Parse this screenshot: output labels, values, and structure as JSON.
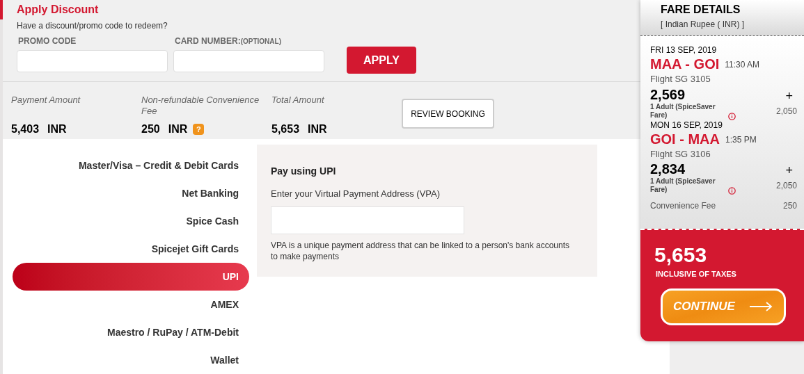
{
  "discount": {
    "title": "Apply Discount",
    "subtitle": "Have a discount/promo code to redeem?",
    "promo_label": "PROMO CODE",
    "card_label": "CARD NUMBER:",
    "card_label_note": "(OPTIONAL)",
    "apply_button": "APPLY"
  },
  "summary": {
    "items": [
      {
        "label": "Payment Amount",
        "amount": "5,403",
        "currency": "INR",
        "help": false
      },
      {
        "label": "Non-refundable Convenience Fee",
        "amount": "250",
        "currency": "INR",
        "help": true,
        "help_icon": "?"
      },
      {
        "label": "Total Amount",
        "amount": "5,653",
        "currency": "INR",
        "help": false
      }
    ],
    "review_button": "REVIEW BOOKING"
  },
  "payment_methods": [
    {
      "label": "Master/Visa – Credit & Debit Cards",
      "selected": false
    },
    {
      "label": "Net Banking",
      "selected": false
    },
    {
      "label": "Spice Cash",
      "selected": false
    },
    {
      "label": "Spicejet Gift Cards",
      "selected": false
    },
    {
      "label": "UPI",
      "selected": true
    },
    {
      "label": "AMEX",
      "selected": false
    },
    {
      "label": "Maestro / RuPay / ATM-Debit",
      "selected": false
    },
    {
      "label": "Wallet",
      "selected": false
    }
  ],
  "upi_panel": {
    "title": "Pay using UPI",
    "field_label": "Enter your Virtual Payment Address (VPA)",
    "note": "VPA is a unique payment address that can be linked to a person's bank accounts to make payments"
  },
  "fare_details": {
    "title": "FARE DETAILS",
    "currency": "[ Indian Rupee ( INR) ]",
    "flights": [
      {
        "date": "FRI 13 SEP, 2019",
        "route": "MAA - GOI",
        "time": "11:30 AM",
        "flight": "Flight SG 3105",
        "price": "2,569",
        "expand": "+",
        "passenger": "1  Adult (SpiceSaver Fare)",
        "passenger_price": "2,050"
      },
      {
        "date": "MON 16 SEP, 2019",
        "route": "GOI - MAA",
        "time": "1:35 PM",
        "flight": "Flight SG 3106",
        "price": "2,834",
        "expand": "+",
        "passenger": "1  Adult (SpiceSaver Fare)",
        "passenger_price": "2,050"
      }
    ],
    "fee_label": "Convenience Fee",
    "fee": "250",
    "total": "5,653",
    "total_note": "INCLUSIVE OF TAXES",
    "continue_button": "CONTINUE"
  }
}
